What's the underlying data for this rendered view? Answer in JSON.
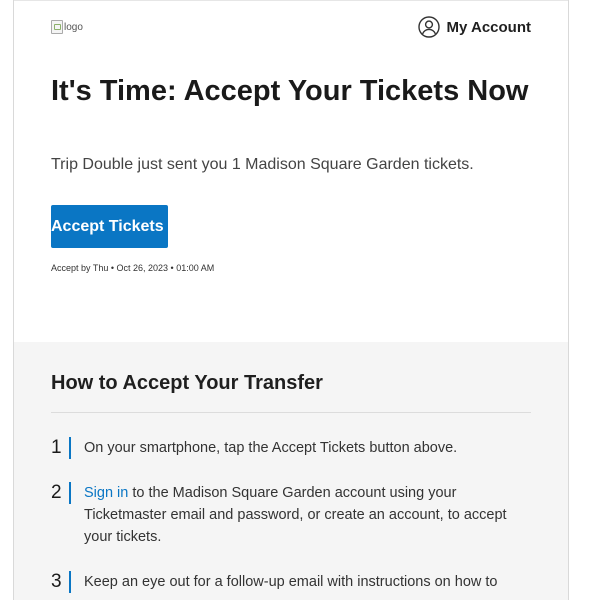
{
  "header": {
    "logo_alt": "logo",
    "account_label": "My Account",
    "account_icon": "user-circle-icon"
  },
  "hero": {
    "title": "It's Time: Accept Your Tickets Now",
    "subtitle": "Trip Double just sent you 1 Madison Square Garden tickets.",
    "accept_button": "Accept Tickets",
    "accept_by": "Accept by Thu • Oct 26, 2023 • 01:00 AM"
  },
  "how_to": {
    "title": "How to Accept Your Transfer",
    "steps": [
      {
        "number": "1",
        "text": "On your smartphone, tap the Accept Tickets button above."
      },
      {
        "number": "2",
        "link": "Sign in",
        "text": " to the Madison Square Garden account using your Ticketmaster email and password, or create an account, to accept your tickets."
      },
      {
        "number": "3",
        "text": "Keep an eye out for a follow-up email with instructions on how to"
      }
    ]
  },
  "colors": {
    "accent": "#0a76c4",
    "section_bg": "#f5f5f5"
  }
}
